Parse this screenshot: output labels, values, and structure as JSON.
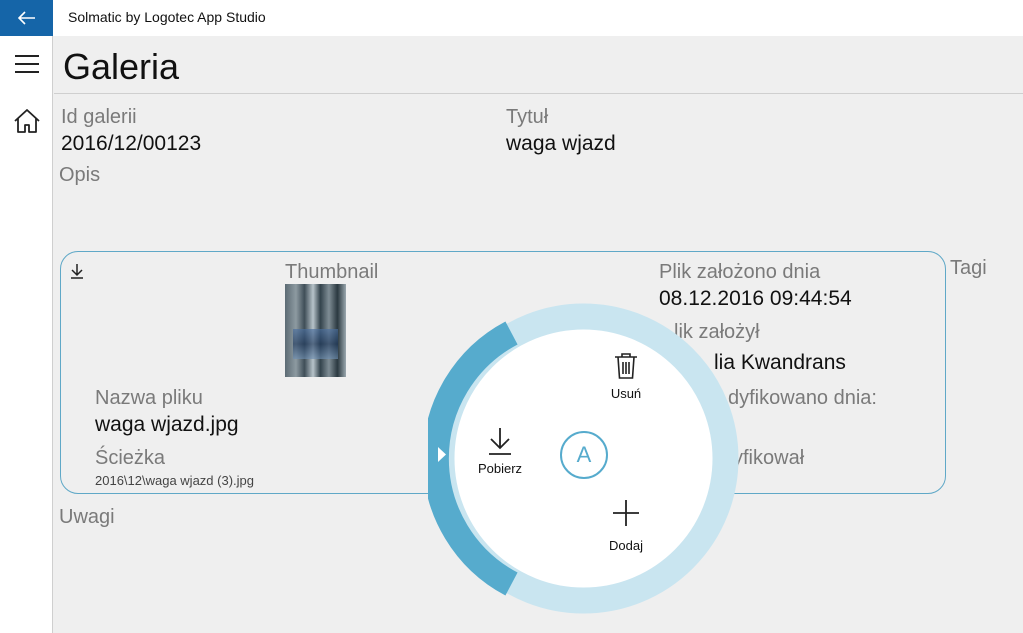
{
  "app": {
    "title": "Solmatic by Logotec App Studio"
  },
  "page": {
    "title": "Galeria"
  },
  "gallery": {
    "id_label": "Id galerii",
    "id_value": "2016/12/00123",
    "title_label": "Tytuł",
    "title_value": "waga wjazd",
    "description_label": "Opis",
    "notes_label": "Uwagi",
    "tags_label": "Tagi"
  },
  "file": {
    "thumbnail_label": "Thumbnail",
    "name_label": "Nazwa pliku",
    "name_value": "waga wjazd.jpg",
    "path_label": "Ścieżka",
    "path_value": "2016\\12\\waga wjazd (3).jpg",
    "created_label": "Plik założono dnia",
    "created_value": "08.12.2016 09:44:54",
    "created_by_label": "lik założył",
    "created_by_value": "lia Kwandrans",
    "modified_label": "dyfikowano dnia:",
    "modified_by_label": "yfikował"
  },
  "radial_menu": {
    "center_label": "A",
    "delete_label": "Usuń",
    "download_label": "Pobierz",
    "add_label": "Dodaj"
  },
  "colors": {
    "accent": "#1565a8",
    "ring_light": "#c9e5f0",
    "ring_dark": "#56abcd",
    "card_border": "#5fa8c7"
  }
}
